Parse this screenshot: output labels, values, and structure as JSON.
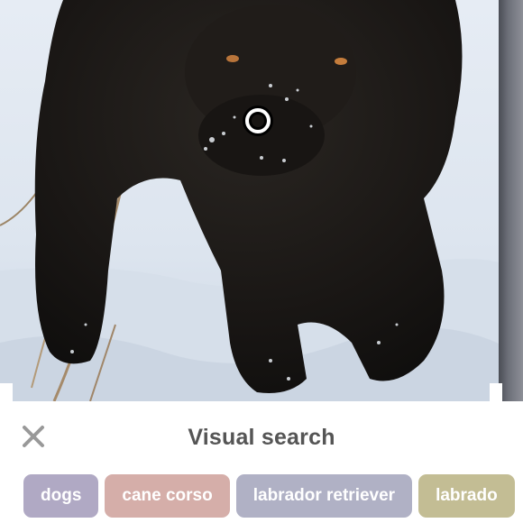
{
  "sheet": {
    "title": "Visual search",
    "close_icon": "close-icon"
  },
  "target": {
    "icon": "circle-target-icon"
  },
  "chips": [
    {
      "label": "dogs",
      "color": "#b0a9c4"
    },
    {
      "label": "cane corso",
      "color": "#d5aea9"
    },
    {
      "label": "labrador retriever",
      "color": "#b0b1c5"
    },
    {
      "label": "labrado",
      "color": "#c3bd94"
    }
  ],
  "colors": {
    "title_text": "#555555",
    "close_icon": "#999999",
    "chip_text": "#ffffff"
  }
}
